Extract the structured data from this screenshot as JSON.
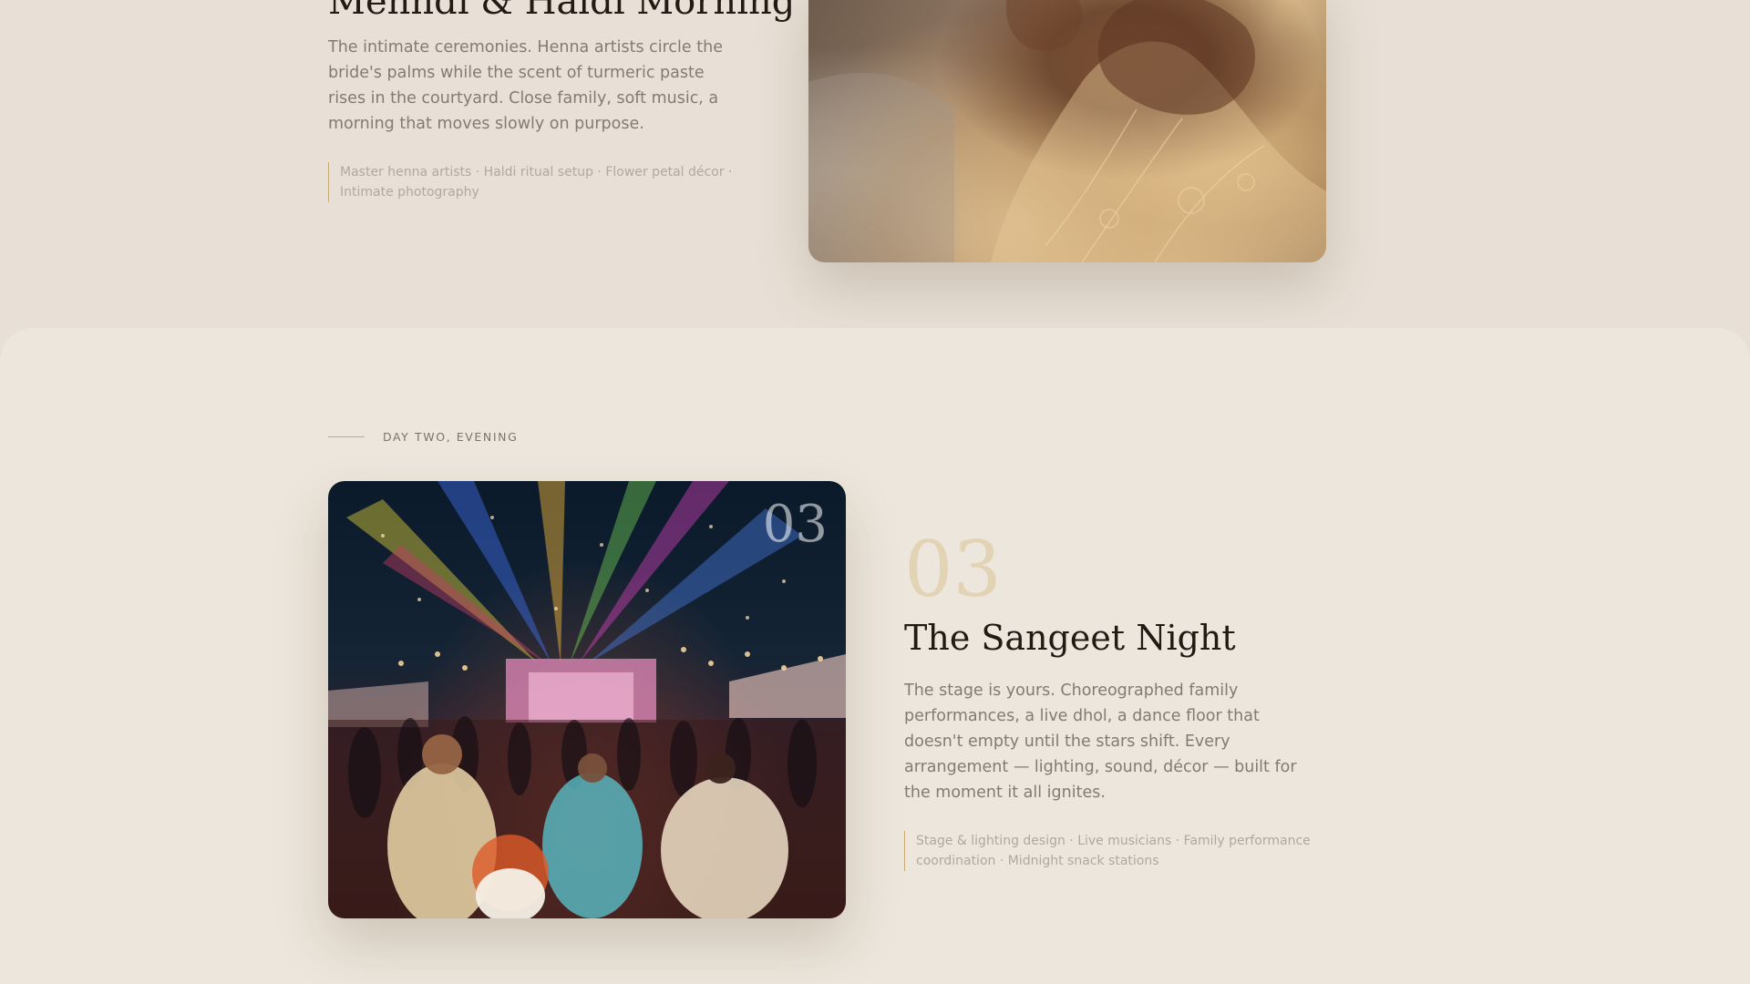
{
  "mehndi": {
    "title": "Mehndi & Haldi Morning",
    "description": "The intimate ceremonies. Henna artists circle the bride's palms while the scent of turmeric paste rises in the courtyard. Close family, soft music, a morning that moves slowly on purpose.",
    "details": "Master henna artists · Haldi ritual setup · Flower petal décor · Intimate photography"
  },
  "sangeet": {
    "eyebrow": "DAY TWO, EVENING",
    "image_number": "03",
    "number": "03",
    "title": "The Sangeet Night",
    "description": "The stage is yours. Choreographed family performances, a live dhol, a dance floor that doesn't empty until the stars shift. Every arrangement — lighting, sound, décor — built for the moment it all ignites.",
    "details": "Stage & lighting design · Live musicians · Family performance coordination · Midnight snack stations"
  },
  "colors": {
    "background": "#e8e0d6",
    "section_background": "#ede6dc",
    "heading": "#241a14",
    "body_text": "#847a70",
    "gold_accent": "#c9ab76",
    "number_accent": "#e1d3b4"
  }
}
